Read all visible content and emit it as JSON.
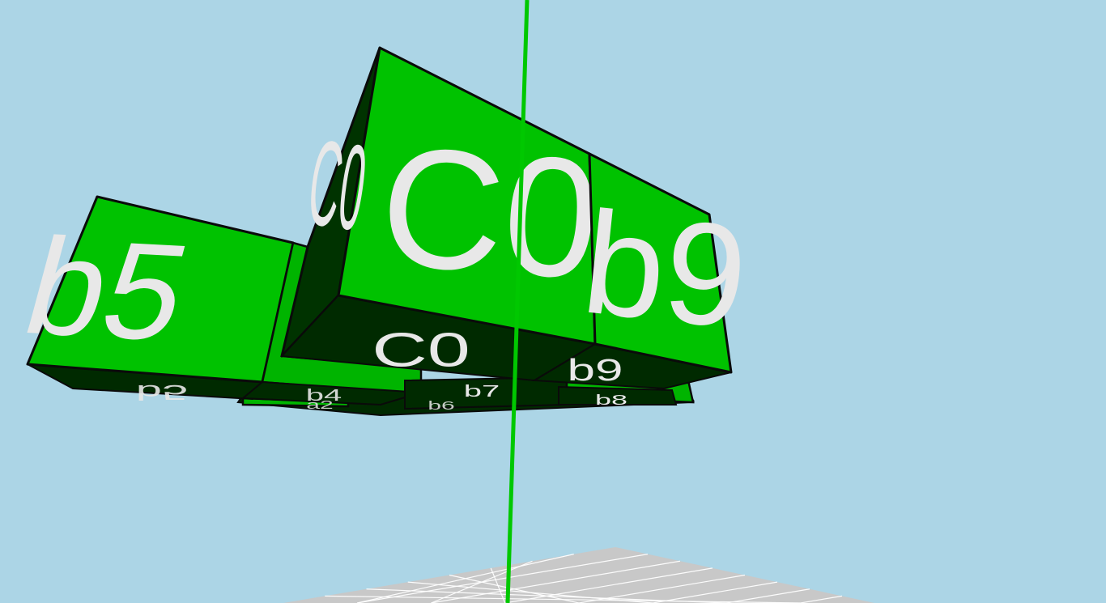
{
  "scene": {
    "background_color": "#acd5e6",
    "cube_color": "#00c200",
    "cube_shadow_color": "#003300",
    "label_color": "#e8e8e8",
    "pole_color": "#00c800",
    "floor_color": "#c8c8c8",
    "floor_grid_color": "#ffffff"
  },
  "blocks": [
    {
      "id": "c0",
      "label": "C0"
    },
    {
      "id": "b9",
      "label": "b9"
    },
    {
      "id": "b5",
      "label": "b5"
    },
    {
      "id": "b4",
      "label": "b4"
    },
    {
      "id": "b7",
      "label": "b7"
    },
    {
      "id": "b8",
      "label": "b8"
    },
    {
      "id": "a2",
      "label": "a2"
    },
    {
      "id": "b6",
      "label": "b6"
    }
  ]
}
